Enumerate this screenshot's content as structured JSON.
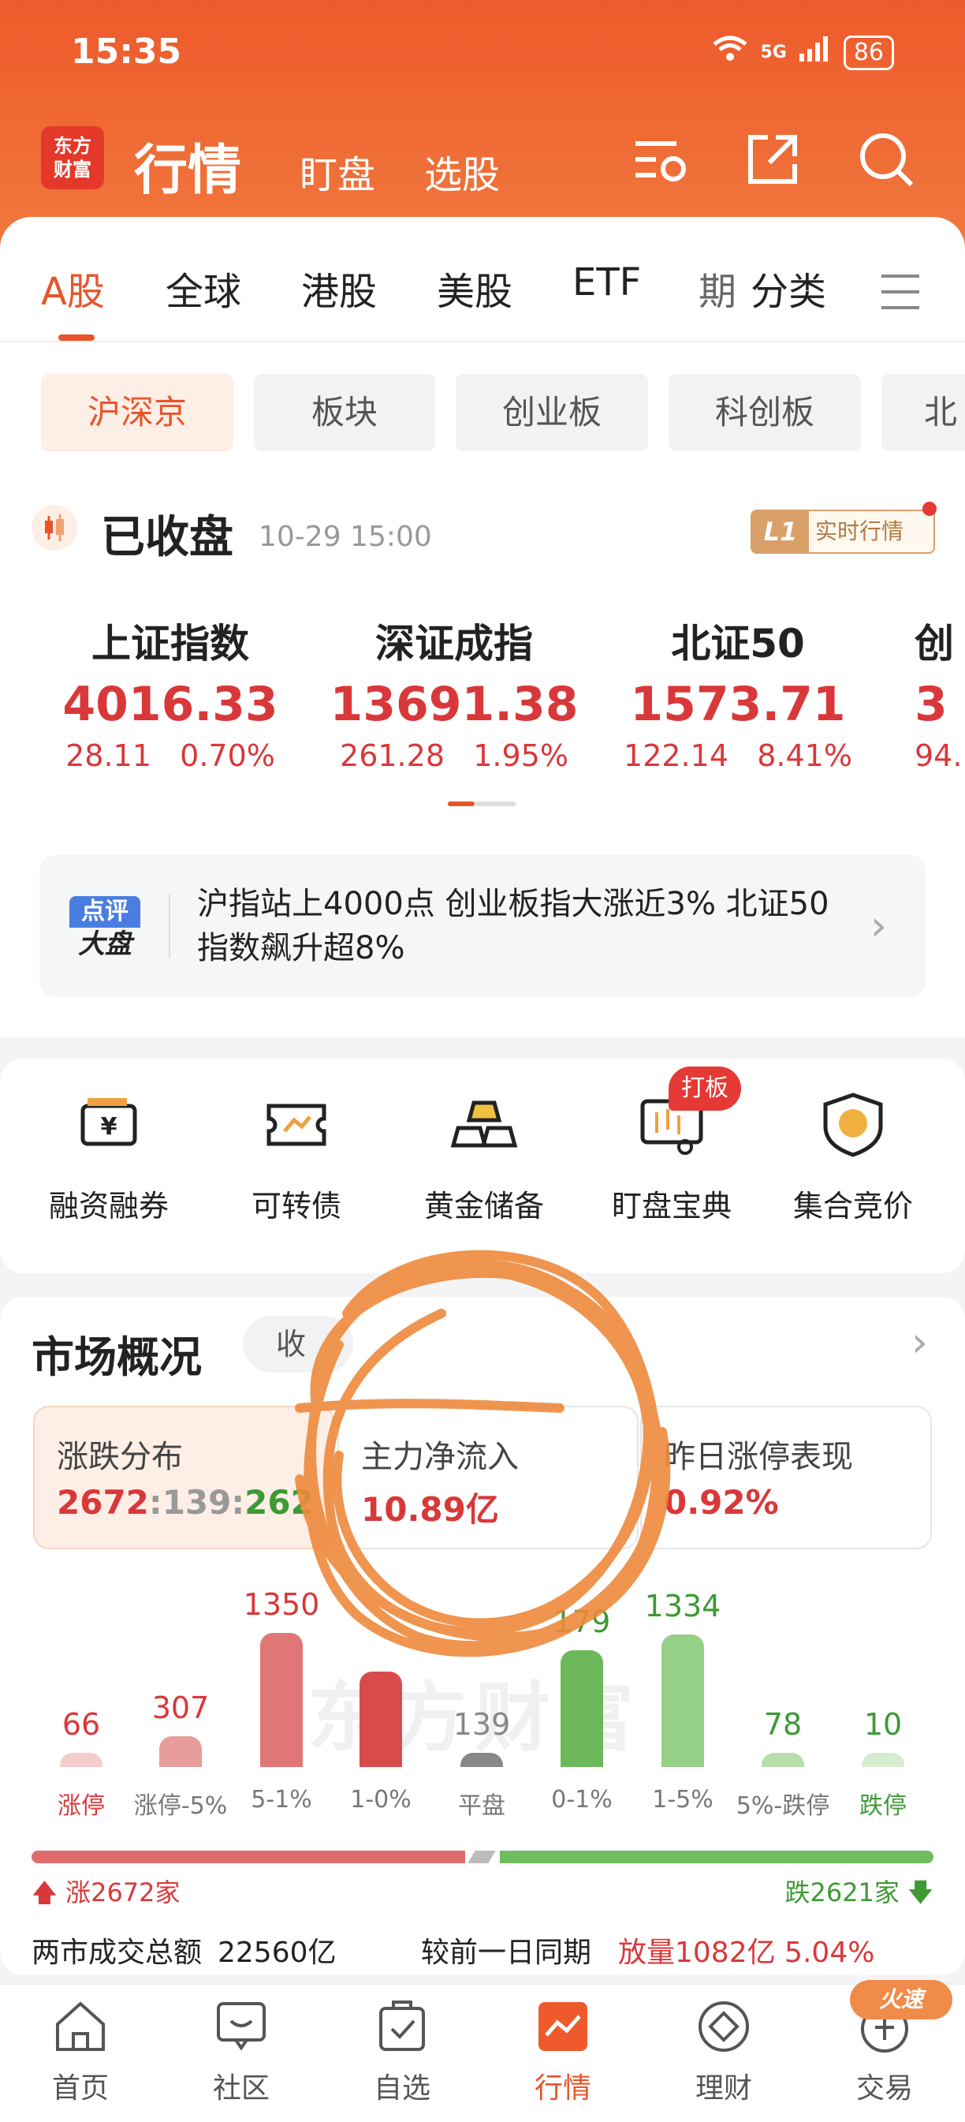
{
  "status": {
    "time": "15:35",
    "network": "5G",
    "battery": "86"
  },
  "header": {
    "logo_line1": "东方",
    "logo_line2": "财富",
    "title": "行情",
    "nav": [
      "盯盘",
      "选股"
    ]
  },
  "tabs": [
    "A股",
    "全球",
    "港股",
    "美股",
    "ETF",
    "期",
    "分类"
  ],
  "segments": [
    "沪深京",
    "板块",
    "创业板",
    "科创板",
    "北"
  ],
  "market_state": {
    "title": "已收盘",
    "time": "10-29 15:00",
    "badge_l1": "L1",
    "badge_text": "实时行情"
  },
  "indices": [
    {
      "name": "上证指数",
      "value": "4016.33",
      "change": "28.11",
      "pct": "0.70%"
    },
    {
      "name": "深证成指",
      "value": "13691.38",
      "change": "261.28",
      "pct": "1.95%"
    },
    {
      "name": "北证50",
      "value": "1573.71",
      "change": "122.14",
      "pct": "8.41%"
    },
    {
      "name": "创",
      "value": "3",
      "change": "94.",
      "pct": ""
    }
  ],
  "news": {
    "badge_top": "点评",
    "badge_bottom": "大盘",
    "text": "沪指站上4000点 创业板指大涨近3% 北证50指数飙升超8%"
  },
  "quick": [
    {
      "label": "融资融券",
      "icon": "yen-ticket-icon"
    },
    {
      "label": "可转债",
      "icon": "bond-ticket-icon"
    },
    {
      "label": "黄金储备",
      "icon": "gold-bars-icon"
    },
    {
      "label": "盯盘宝典",
      "icon": "monitor-chart-icon",
      "badge": "打板"
    },
    {
      "label": "集合竞价",
      "icon": "bid-shield-icon"
    }
  ],
  "market": {
    "title": "市场概况",
    "pill": "收",
    "cards": [
      {
        "title": "涨跌分布",
        "up": "2672",
        "flat": "139",
        "down": "262"
      },
      {
        "title": "主力净流入",
        "value": "10.89亿"
      },
      {
        "title": "昨日涨停表现",
        "value": "0.92%"
      }
    ],
    "up_count": "涨2672家",
    "down_count": "跌2621家",
    "turnover_label": "两市成交总额",
    "turnover_value": "22560亿",
    "compare_label": "较前一日同期",
    "compare_value": "放量1082亿  5.04%",
    "watermark": "东方财富",
    "colors": {
      "up": "#d9383a",
      "down": "#3d9a35"
    }
  },
  "chart_data": {
    "type": "bar",
    "categories": [
      "涨停",
      "涨停-5%",
      "5-1%",
      "1-0%",
      "平盘",
      "0-1%",
      "1-5%",
      "5%-跌停",
      "跌停"
    ],
    "values": [
      66,
      307,
      1350,
      959,
      139,
      1179,
      1334,
      78,
      10
    ],
    "value_labels": [
      "66",
      "307",
      "1350",
      "",
      "139",
      "179",
      "1334",
      "78",
      "10"
    ]
  },
  "bottom_nav": [
    {
      "label": "首页",
      "icon": "home-icon"
    },
    {
      "label": "社区",
      "icon": "community-icon"
    },
    {
      "label": "自选",
      "icon": "watchlist-icon"
    },
    {
      "label": "行情",
      "icon": "market-icon",
      "active": true
    },
    {
      "label": "理财",
      "icon": "wealth-icon"
    },
    {
      "label": "交易",
      "icon": "trade-icon",
      "badge": "火速"
    }
  ]
}
